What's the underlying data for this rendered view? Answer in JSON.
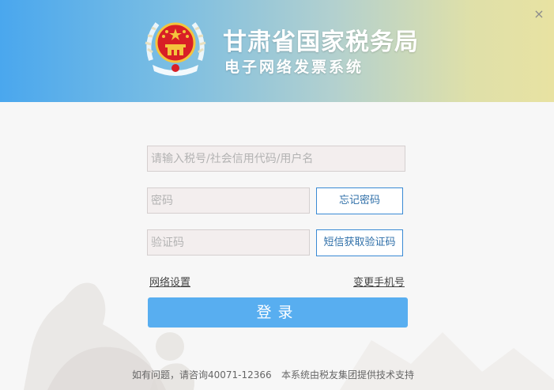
{
  "header": {
    "title": "甘肃省国家税务局",
    "subtitle": "电子网络发票系统",
    "close_symbol": "×",
    "emblem_icon": "national-emblem-icon",
    "gradient": [
      "#4aa7ee",
      "#b2d0cf",
      "#e8e2a2"
    ]
  },
  "form": {
    "username_placeholder": "请输入税号/社会信用代码/用户名",
    "password_placeholder": "密码",
    "captcha_placeholder": "验证码",
    "forgot_password_label": "忘记密码",
    "sms_captcha_label": "短信获取验证码",
    "network_settings_label": "网络设置",
    "change_phone_label": "变更手机号",
    "login_label": "登录"
  },
  "footer": {
    "contact": "如有问题，请咨询40071-12366",
    "support": "本系统由税友集团提供技术支持"
  },
  "colors": {
    "accent": "#58aef0",
    "button_border": "#3a8ad4",
    "input_bg": "#f3eeee"
  }
}
